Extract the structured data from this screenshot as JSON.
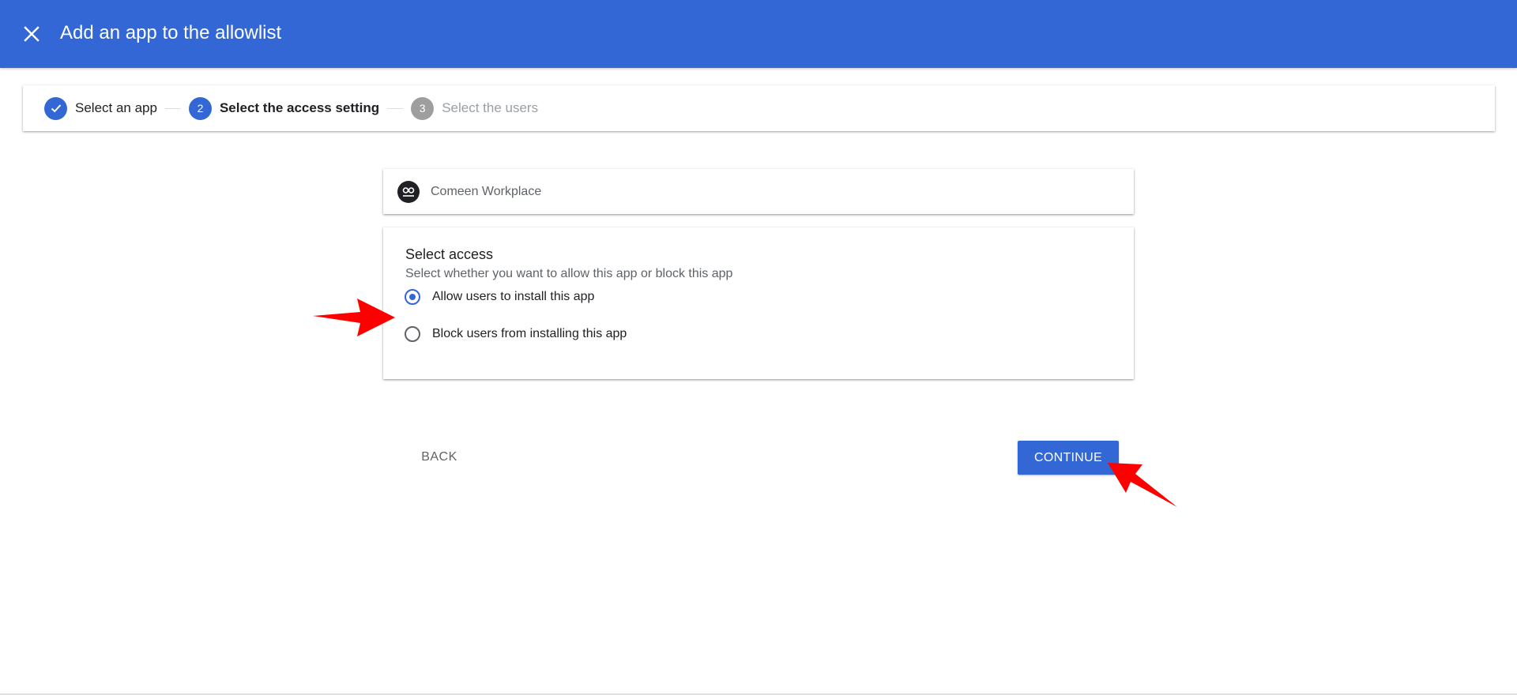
{
  "header": {
    "title": "Add an app to the allowlist",
    "close_icon": "close-icon",
    "background_color": "#3367d6"
  },
  "stepper": {
    "steps": [
      {
        "number": "1",
        "label": "Select an app",
        "state": "done"
      },
      {
        "number": "2",
        "label": "Select the access setting",
        "state": "active"
      },
      {
        "number": "3",
        "label": "Select the users",
        "state": "pending"
      }
    ]
  },
  "app": {
    "name": "Comeen Workplace",
    "logo_icon": "comeen-logo-icon"
  },
  "access": {
    "title": "Select access",
    "subtitle": "Select whether you want to allow this app or block this app",
    "options": [
      {
        "label": "Allow users to install this app",
        "selected": true
      },
      {
        "label": "Block users from installing this app",
        "selected": false
      }
    ]
  },
  "actions": {
    "back_label": "BACK",
    "continue_label": "CONTINUE"
  },
  "annotations": {
    "arrow_color": "#ff0000"
  }
}
